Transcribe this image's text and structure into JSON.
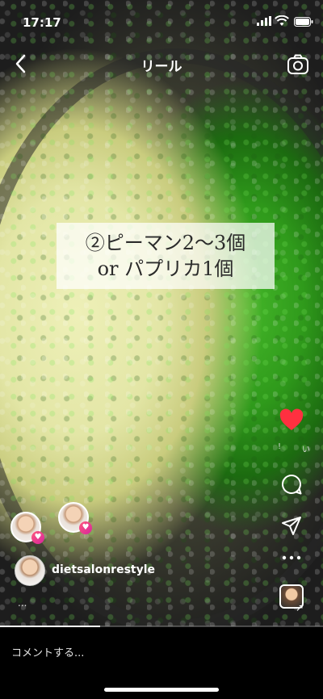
{
  "status_bar": {
    "time": "17:17"
  },
  "header": {
    "title": "リール",
    "back_icon": "chevron-left-icon",
    "camera_icon": "camera-icon"
  },
  "video": {
    "caption_line1": "②ピーマン2〜3個",
    "caption_line2": "or パプリカ1個",
    "progress_fraction": 0.31
  },
  "actions": {
    "like_icon": "heart-icon",
    "like_color": "#ff3040",
    "like_count_left": "!",
    "like_count_right": "い",
    "comment_icon": "speech-bubble-icon",
    "share_icon": "paper-plane-icon",
    "more_icon": "more-dots-icon"
  },
  "author": {
    "username": "dietsalonrestyle",
    "caption_more": "..."
  },
  "comment": {
    "placeholder": "コメントする..."
  }
}
